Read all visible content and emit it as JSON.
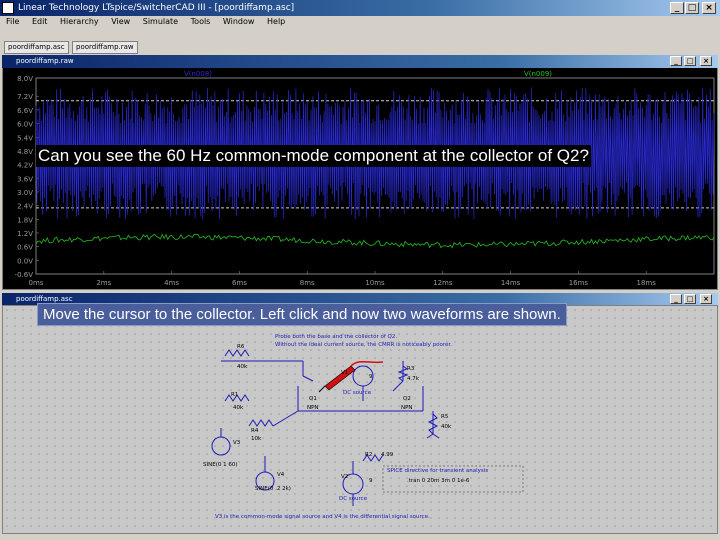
{
  "app": {
    "title": "Linear Technology LTspice/SwitcherCAD III - [poordiffamp.asc]",
    "menu": [
      "File",
      "Edit",
      "Hierarchy",
      "View",
      "Simulate",
      "Tools",
      "Window",
      "Help"
    ],
    "tabs": [
      "poordiffamp.asc",
      "poordiffamp.raw"
    ]
  },
  "waveform_window": {
    "title": "poordiffamp.raw",
    "trace_labels": [
      "V(n008)",
      "V(n009)"
    ]
  },
  "schematic_window": {
    "title": "poordiffamp.asc",
    "annotation_1": "Probe both the base and the collector of Q2.",
    "annotation_2": "Without the ideal current source, the CMRR is noticeably poorer.",
    "directive_title": "SPICE directive for transient analysis",
    "directive": ".tran 0 20m 3m 0 1e-6",
    "footer_note": "V3 is the common-mode signal source and V4 is the differential signal source.",
    "components": {
      "R6": "R6",
      "R6v": "40k",
      "R1": "R1",
      "R1v": "40k",
      "R3": "R3",
      "R3v": "4.7k",
      "R4": "R4",
      "R4v": "10k",
      "R5": "R5",
      "R5v": "40k",
      "R2": "R2",
      "R2v": "4.99",
      "V1": "V1",
      "V1v": "9",
      "V2": "V2",
      "V2v": "9",
      "V3": "V3",
      "V3v": "SINE(0 1 60)",
      "V4": "V4",
      "V4v": "SINE(0 .2 2k)",
      "Q1": "Q1",
      "Q2": "Q2",
      "Qt": "NPN",
      "dc1": "DC source",
      "dc2": "DC source"
    }
  },
  "captions": {
    "question": "Can you see the 60 Hz common-mode component at the collector of Q2?",
    "instruction": "Move the cursor to the collector.  Left click and now two waveforms are shown."
  },
  "chart_data": {
    "type": "line",
    "title": "",
    "xlabel": "",
    "ylabel": "",
    "x_ticks": [
      "0ms",
      "2ms",
      "4ms",
      "6ms",
      "8ms",
      "10ms",
      "12ms",
      "14ms",
      "16ms",
      "18ms"
    ],
    "y_ticks": [
      "8.0V",
      "7.2V",
      "6.6V",
      "6.0V",
      "5.4V",
      "4.8V",
      "4.2V",
      "3.6V",
      "3.0V",
      "2.4V",
      "1.8V",
      "1.2V",
      "0.6V",
      "0.0V",
      "-0.6V"
    ],
    "xlim": [
      0,
      20
    ],
    "ylim": [
      -0.6,
      8.0
    ],
    "series": [
      {
        "name": "V(n008)",
        "color": "#2a2ad8",
        "approx_min": 1.8,
        "approx_max": 7.6
      },
      {
        "name": "V(n009)",
        "color": "#22c022",
        "approx_min": 0.5,
        "approx_max": 1.2
      }
    ],
    "cursor_lines_V": [
      7.0,
      2.3
    ]
  }
}
